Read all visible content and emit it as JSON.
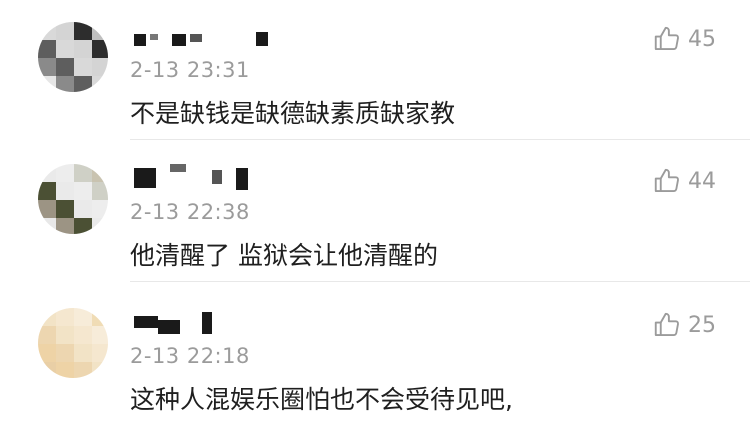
{
  "comments": [
    {
      "time": "2-13 23:31",
      "text": "不是缺钱是缺德缺素质缺家教",
      "likes": "45",
      "avatar_colors": [
        "#d9d9d9",
        "#bfbfbf",
        "#8a8a8a",
        "#d4d4d4",
        "#a8a8a8",
        "#5e5e5e",
        "#2d2d2d",
        "#e6e6e6"
      ]
    },
    {
      "time": "2-13 22:38",
      "text": "他清醒了 监狱会让他清醒的",
      "likes": "44",
      "avatar_colors": [
        "#eaeaea",
        "#c9c3b0",
        "#9c9484",
        "#ededed",
        "#6f6a58",
        "#4b5034",
        "#cfd0c6",
        "#e8e8e8"
      ]
    },
    {
      "time": "2-13 22:18",
      "text": "这种人混娱乐圈怕也不会受待见吧,",
      "likes": "25",
      "avatar_colors": [
        "#f2e3c6",
        "#f0dcb5",
        "#eed3a6",
        "#f5e7cf",
        "#e7c99b",
        "#edd6b0",
        "#f7ecd9",
        "#e9cfa6"
      ]
    }
  ],
  "icons": {
    "like": "thumbs-up-icon"
  }
}
